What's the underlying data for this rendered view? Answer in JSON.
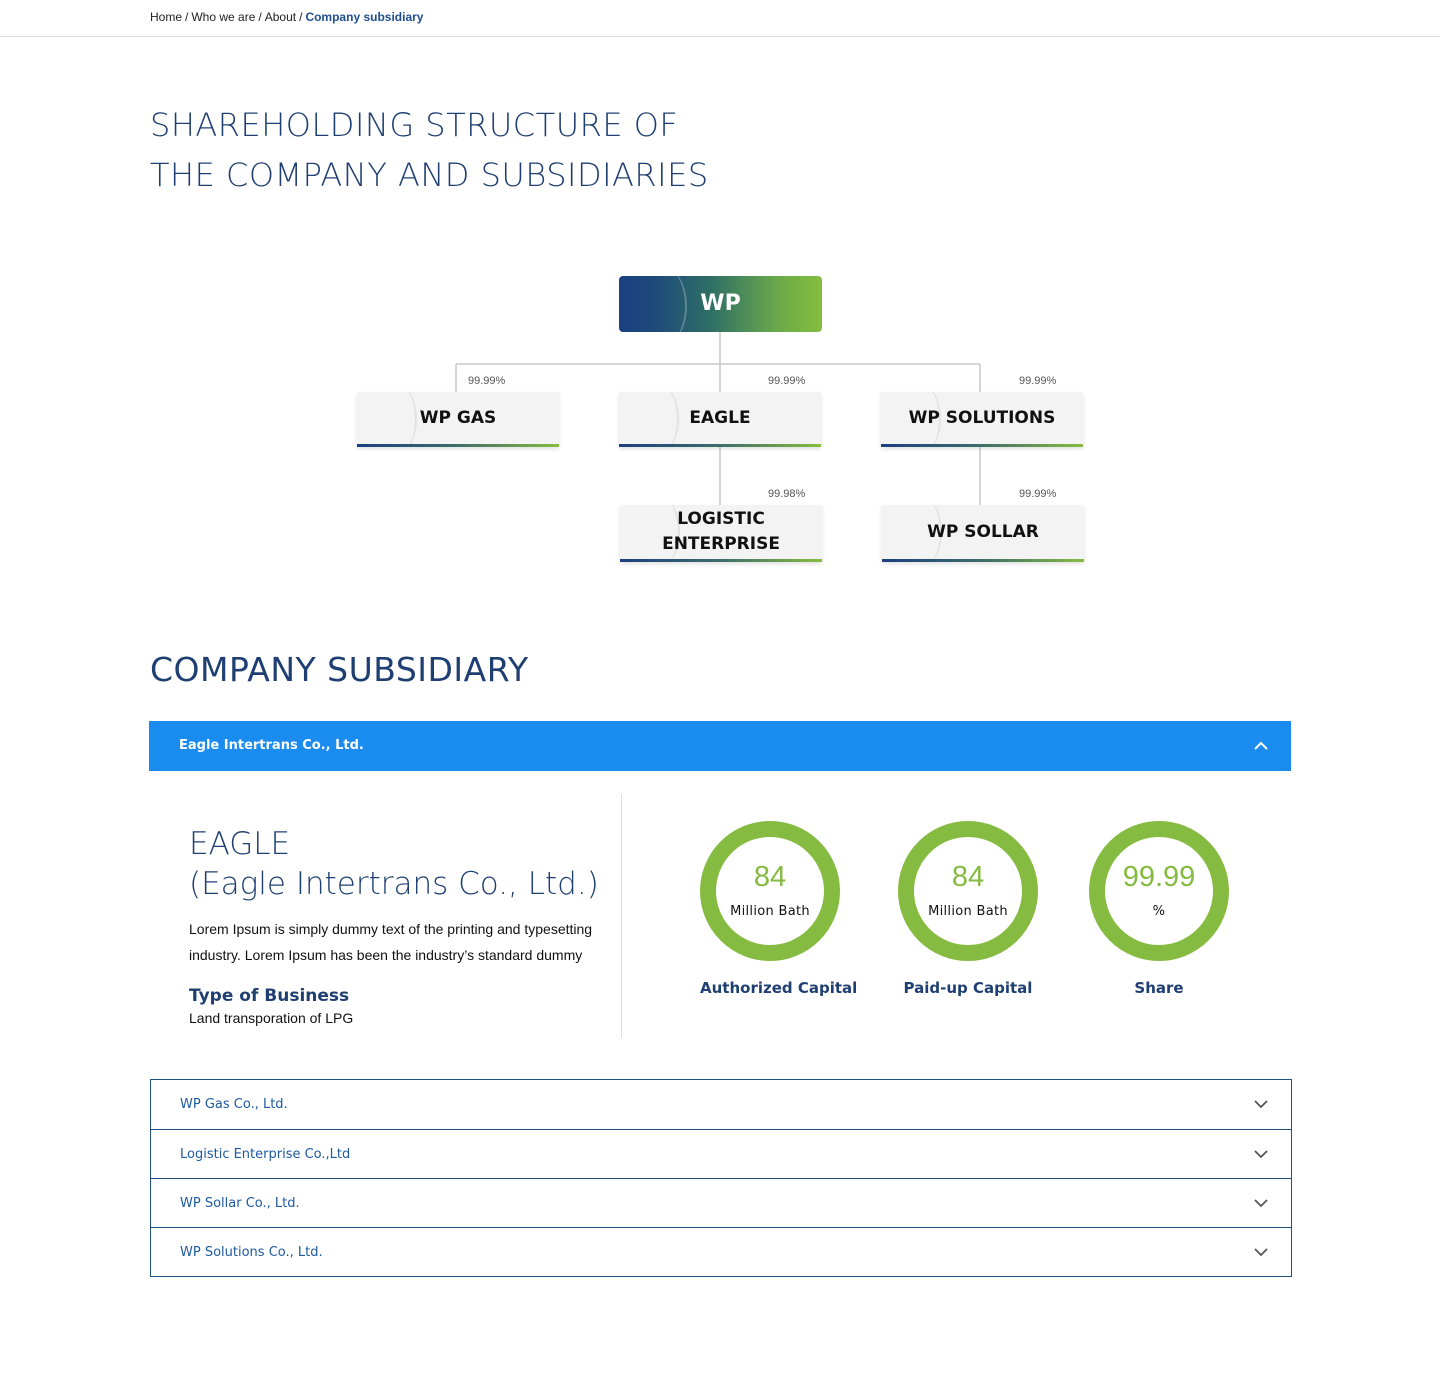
{
  "breadcrumb": {
    "items": [
      "Home",
      "Who we are",
      "About"
    ],
    "current": "Company subsidiary"
  },
  "heading": {
    "line1": "SHAREHOLDING STRUCTURE OF",
    "line2": "THE COMPANY AND SUBSIDIARIES"
  },
  "org_chart": {
    "root": "WP",
    "nodes": [
      {
        "label": "WP GAS",
        "share": "99.99%"
      },
      {
        "label": "EAGLE",
        "share": "99.99%"
      },
      {
        "label": "WP SOLUTIONS",
        "share": "99.99%"
      },
      {
        "label": "LOGISTIC ENTERPRISE",
        "share": "99.98%"
      },
      {
        "label": "WP SOLLAR",
        "share": "99.99%"
      }
    ]
  },
  "subsidiary": {
    "title": "COMPANY SUBSIDIARY",
    "open_item": {
      "header": "Eagle Intertrans Co., Ltd.",
      "name_line1": "EAGLE",
      "name_line2": "(Eagle Intertrans Co., Ltd.)",
      "description": "Lorem Ipsum is simply dummy text of the printing and typesetting industry. Lorem Ipsum has been the industry’s standard dummy",
      "type_label": "Type of Business",
      "type_value": "Land transporation of LPG",
      "stats": [
        {
          "value": "84",
          "unit": "Million Bath",
          "caption": "Authorized Capital"
        },
        {
          "value": "84",
          "unit": "Million Bath",
          "caption": "Paid-up Capital"
        },
        {
          "value": "99.99",
          "unit": "%",
          "caption": "Share"
        }
      ]
    },
    "items": [
      "WP Gas Co., Ltd.",
      "Logistic Enterprise Co.,Ltd",
      "WP Sollar Co., Ltd.",
      "WP Solutions Co., Ltd."
    ]
  },
  "colors": {
    "brand_blue": "#1f3f72",
    "accordion_active": "#1a8cf0",
    "accent_green": "#86bb41"
  },
  "icons": {
    "collapse": "chevron-up-icon",
    "expand": "chevron-down-icon"
  }
}
